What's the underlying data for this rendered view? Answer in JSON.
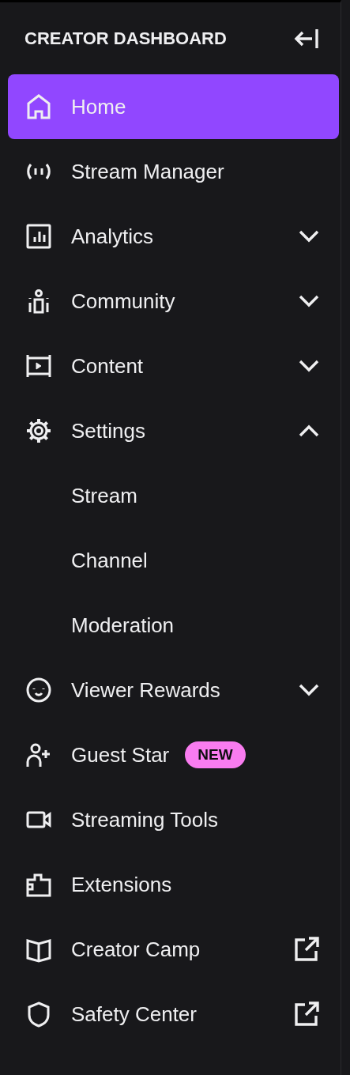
{
  "header": {
    "title": "CREATOR DASHBOARD"
  },
  "items": [
    {
      "label": "Home",
      "selected": true,
      "kind": "plain"
    },
    {
      "label": "Stream Manager",
      "selected": false,
      "kind": "plain"
    },
    {
      "label": "Analytics",
      "selected": false,
      "kind": "expandable",
      "expanded": false
    },
    {
      "label": "Community",
      "selected": false,
      "kind": "expandable",
      "expanded": false
    },
    {
      "label": "Content",
      "selected": false,
      "kind": "expandable",
      "expanded": false
    },
    {
      "label": "Settings",
      "selected": false,
      "kind": "expandable",
      "expanded": true,
      "children": [
        {
          "label": "Stream",
          "selected": false
        },
        {
          "label": "Channel",
          "selected": false
        },
        {
          "label": "Moderation",
          "selected": false
        }
      ]
    },
    {
      "label": "Viewer Rewards",
      "selected": false,
      "kind": "expandable",
      "expanded": false
    },
    {
      "label": "Guest Star",
      "selected": false,
      "kind": "plain",
      "badge": "NEW"
    },
    {
      "label": "Streaming Tools",
      "selected": false,
      "kind": "plain"
    },
    {
      "label": "Extensions",
      "selected": false,
      "kind": "plain"
    },
    {
      "label": "Creator Camp",
      "selected": false,
      "kind": "external"
    },
    {
      "label": "Safety Center",
      "selected": false,
      "kind": "external"
    }
  ]
}
